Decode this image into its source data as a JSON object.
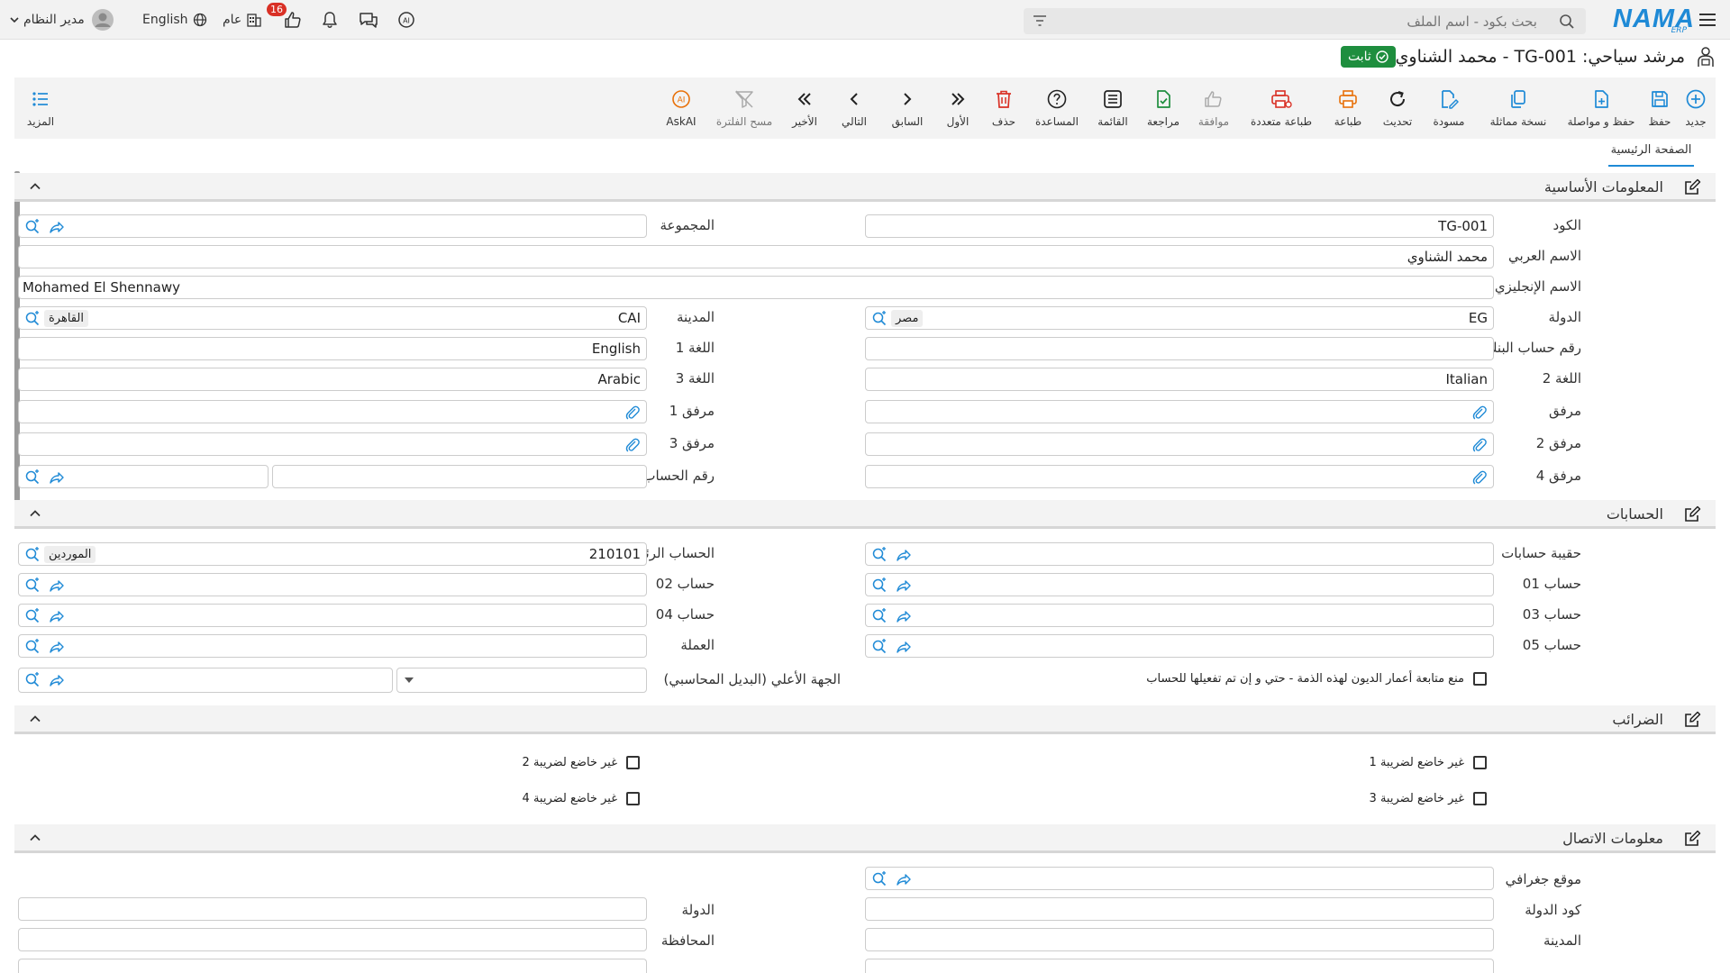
{
  "topbar": {
    "menu_icon": "hamburger-icon",
    "logo_text": "NAMA",
    "logo_sub": "ERP",
    "search_placeholder": "بحث بكود - اسم الملف",
    "user_name": "مدير النظام",
    "language": "English",
    "scope": "عام",
    "notification_count": "16"
  },
  "title": {
    "text": "مرشد سياحي: TG-001 - محمد الشناوي",
    "status": "ثابت"
  },
  "toolbar": {
    "new": "جديد",
    "save": "حفظ",
    "save_continue": "حفظ و مواصلة",
    "copy": "نسخة مماثلة",
    "draft": "مسودة",
    "refresh": "تحديث",
    "print": "طباعة",
    "multi_print": "طباعة متعددة",
    "approve": "موافقة",
    "review": "مراجعة",
    "list": "القائمة",
    "help": "المساعدة",
    "delete": "حذف",
    "first": "الأول",
    "previous": "السابق",
    "next": "التالي",
    "last": "الأخير",
    "clear_filter": "مسح الفلترة",
    "askai": "AskAI",
    "more": "المزيد"
  },
  "tabs": {
    "home": "الصفحة الرئيسية"
  },
  "sections": {
    "basic": "المعلومات الأساسية",
    "accounts": "الحسابات",
    "taxes": "الضرائب",
    "contact": "معلومات الاتصال"
  },
  "basic": {
    "code_label": "الكود",
    "code_value": "TG-001",
    "group_label": "المجموعة",
    "arabic_name_label": "الاسم العربي",
    "arabic_name_value": "محمد الشناوي",
    "english_name_label": "الاسم الإنجليزي",
    "english_name_value": "Mohamed El Shennawy",
    "country_label": "الدولة",
    "country_code": "EG",
    "country_name": "مصر",
    "city_label": "المدينة",
    "city_code": "CAI",
    "city_name": "القاهرة",
    "bank_account_label": "رقم حساب البنك",
    "lang1_label": "اللغة 1",
    "lang1_value": "English",
    "lang2_label": "اللغة 2",
    "lang2_value": "Italian",
    "lang3_label": "اللغة 3",
    "lang3_value": "Arabic",
    "attachment_label": "مرفق",
    "attachment1_label": "مرفق 1",
    "attachment2_label": "مرفق 2",
    "attachment3_label": "مرفق 3",
    "attachment4_label": "مرفق 4",
    "bank_currency_label": "رقم الحساب البنكي / العملة"
  },
  "accounts": {
    "bag_label": "حقيبة حسابات",
    "main_label": "الحساب الرئيسي",
    "main_code": "210101",
    "main_name": "الموردين",
    "acc01_label": "حساب 01",
    "acc02_label": "حساب 02",
    "acc03_label": "حساب 03",
    "acc04_label": "حساب 04",
    "acc05_label": "حساب 05",
    "currency_label": "العملة",
    "parent_label": "الجهة الأعلي (البديل المحاسبي)",
    "prevent_aging_label": "منع متابعة أعمار الديون لهذه الذمة - حتي و إن تم تفعيلها للحساب"
  },
  "taxes": {
    "tax1": "غير خاضع لضريبة 1",
    "tax2": "غير خاضع لضريبة 2",
    "tax3": "غير خاضع لضريبة 3",
    "tax4": "غير خاضع لضريبة 4"
  },
  "contact": {
    "geo_label": "موقع جغرافي",
    "country_code_label": "كود الدولة",
    "country_label": "الدولة",
    "city_label": "المدينة",
    "governorate_label": "المحافظة"
  },
  "colors": {
    "accent": "#1f8ad6",
    "success": "#1e8e3e",
    "danger": "#d93025",
    "orange": "#e8710a"
  }
}
